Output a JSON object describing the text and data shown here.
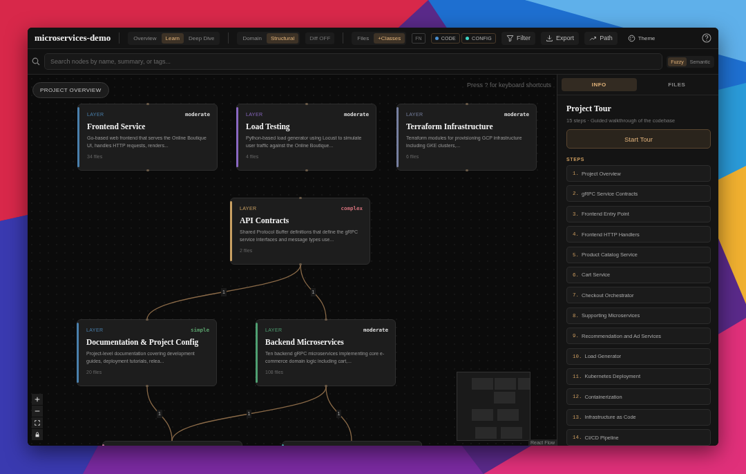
{
  "app": {
    "title": "microservices-demo"
  },
  "toolbar": {
    "view_modes": [
      {
        "label": "Overview",
        "selected": false
      },
      {
        "label": "Learn",
        "selected": true
      },
      {
        "label": "Deep Dive",
        "selected": false
      }
    ],
    "lenses": [
      {
        "label": "Domain",
        "selected": false
      },
      {
        "label": "Structural",
        "selected": true
      }
    ],
    "diff": {
      "label": "Diff OFF",
      "on": false
    },
    "granularity": [
      {
        "label": "Files",
        "selected": false
      },
      {
        "label": "+Classes",
        "selected": true
      }
    ],
    "fn_toggle": {
      "label": "FN",
      "on": false
    },
    "categories": [
      {
        "label": "CODE",
        "color": "#4a8fd0"
      },
      {
        "label": "CONFIG",
        "color": "#3fd6c6"
      }
    ],
    "actions": [
      {
        "label": "Filter"
      },
      {
        "label": "Export"
      },
      {
        "label": "Path"
      },
      {
        "label": "Theme"
      }
    ]
  },
  "search": {
    "placeholder": "Search nodes by name, summary, or tags...",
    "modes": [
      {
        "label": "Fuzzy",
        "selected": true
      },
      {
        "label": "Semantic",
        "selected": false
      }
    ]
  },
  "canvas": {
    "overview_button": "PROJECT OVERVIEW",
    "hint": "Press ? for keyboard shortcuts",
    "nodes": [
      {
        "type_label": "LAYER",
        "complexity": {
          "text": "moderate",
          "color": "#dddddd"
        },
        "title": "Frontend Service",
        "summary": "Go-based web frontend that serves the Online Boutique UI, handles HTTP requests, renders...",
        "files": "34 files",
        "color": "#4a80ad"
      },
      {
        "type_label": "LAYER",
        "complexity": {
          "text": "moderate",
          "color": "#dddddd"
        },
        "title": "Load Testing",
        "summary": "Python-based load generator using Locust to simulate user traffic against the Online Boutique...",
        "files": "4 files",
        "color": "#8a68c2"
      },
      {
        "type_label": "LAYER",
        "complexity": {
          "text": "moderate",
          "color": "#dddddd"
        },
        "title": "Terraform Infrastructure",
        "summary": "Terraform modules for provisioning GCP infrastructure including GKE clusters,...",
        "files": "6 files",
        "color": "#7780a0"
      },
      {
        "type_label": "LAYER",
        "complexity": {
          "text": "complex",
          "color": "#d0707a"
        },
        "title": "API Contracts",
        "summary": "Shared Protocol Buffer definitions that define the gRPC service interfaces and message types use...",
        "files": "2 files",
        "color": "#c9a063"
      },
      {
        "type_label": "LAYER",
        "complexity": {
          "text": "simple",
          "color": "#5aa06c"
        },
        "title": "Documentation & Project Config",
        "summary": "Project-level documentation covering development guides, deployment tutorials, relea...",
        "files": "20 files",
        "color": "#4a80ad"
      },
      {
        "type_label": "LAYER",
        "complexity": {
          "text": "moderate",
          "color": "#dddddd"
        },
        "title": "Backend Microservices",
        "summary": "Ten backend gRPC microservices implementing core e-commerce domain logic including cart,...",
        "files": "108 files",
        "color": "#4fa072"
      }
    ],
    "partial_nodes": [
      {
        "color": "#c47a92"
      },
      {
        "color": "#3ea39c"
      }
    ],
    "edges": [
      {
        "label": "1"
      },
      {
        "label": "1"
      },
      {
        "label": "1"
      },
      {
        "label": "1"
      },
      {
        "label": "1"
      }
    ],
    "attribution": "React Flow"
  },
  "panel": {
    "tabs": [
      {
        "label": "INFO",
        "selected": true
      },
      {
        "label": "FILES",
        "selected": false
      }
    ],
    "tour": {
      "title": "Project Tour",
      "subtitle": "15 steps · Guided walkthrough of the codebase",
      "start_button": "Start Tour",
      "steps_heading": "STEPS",
      "steps": [
        {
          "number": "1.",
          "title": "Project Overview"
        },
        {
          "number": "2.",
          "title": "gRPC Service Contracts"
        },
        {
          "number": "3.",
          "title": "Frontend Entry Point"
        },
        {
          "number": "4.",
          "title": "Frontend HTTP Handlers"
        },
        {
          "number": "5.",
          "title": "Product Catalog Service"
        },
        {
          "number": "6.",
          "title": "Cart Service"
        },
        {
          "number": "7.",
          "title": "Checkout Orchestrator"
        },
        {
          "number": "8.",
          "title": "Supporting Microservices"
        },
        {
          "number": "9.",
          "title": "Recommendation and Ad Services"
        },
        {
          "number": "10.",
          "title": "Load Generator"
        },
        {
          "number": "11.",
          "title": "Kubernetes Deployment"
        },
        {
          "number": "12.",
          "title": "Containerization"
        },
        {
          "number": "13.",
          "title": "Infrastructure as Code"
        },
        {
          "number": "14.",
          "title": "CI/CD Pipeline"
        }
      ]
    }
  }
}
